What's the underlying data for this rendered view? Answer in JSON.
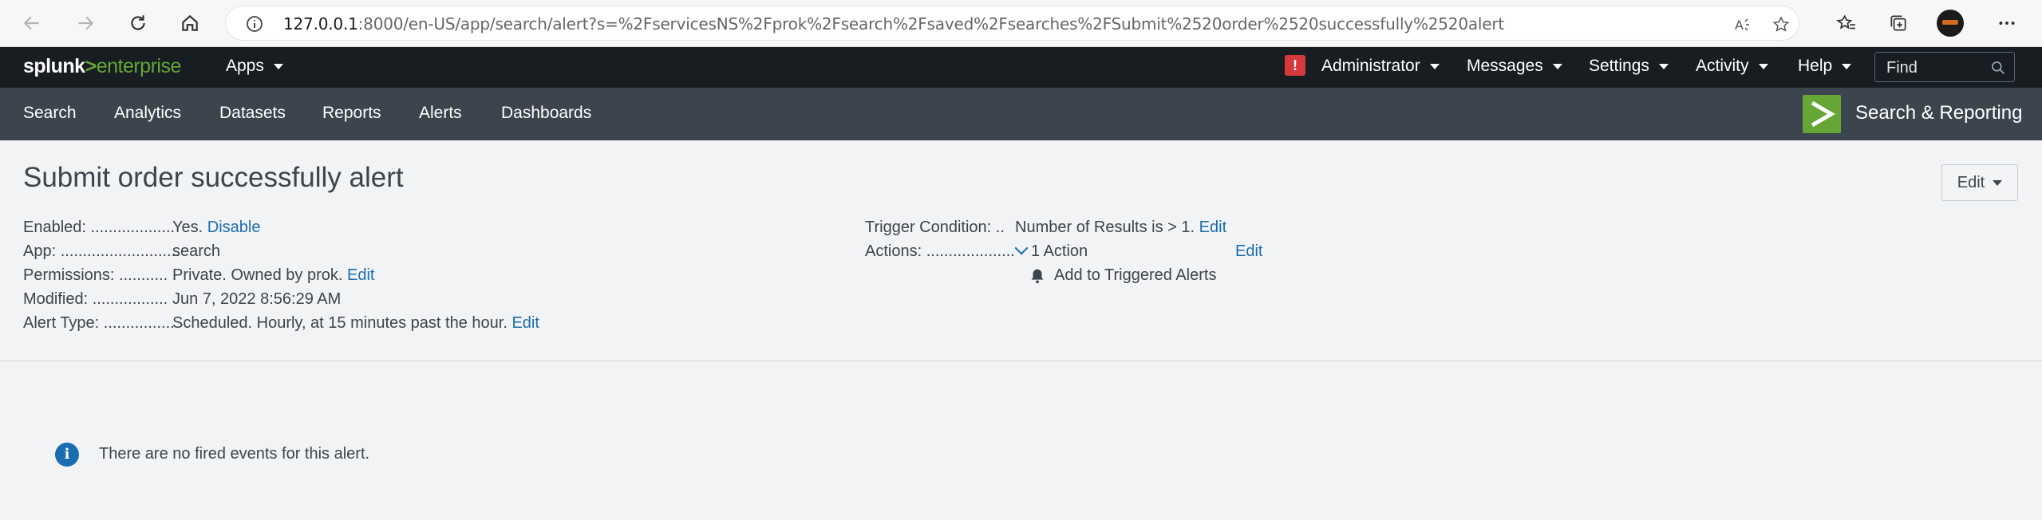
{
  "browser": {
    "url_host": "127.0.0.1",
    "url_rest": ":8000/en-US/app/search/alert?s=%2FservicesNS%2Fprok%2Fsearch%2Fsaved%2Fsearches%2FSubmit%2520order%2520successfully%2520alert"
  },
  "splunk_header": {
    "logo_splunk": "splunk",
    "logo_gt": ">",
    "logo_enterprise": "enterprise",
    "apps_label": "Apps",
    "alert_badge": "!",
    "menus": [
      "Administrator",
      "Messages",
      "Settings",
      "Activity",
      "Help"
    ],
    "find_placeholder": "Find"
  },
  "app_bar": {
    "nav": [
      "Search",
      "Analytics",
      "Datasets",
      "Reports",
      "Alerts",
      "Dashboards"
    ],
    "app_logo_glyph": ">",
    "app_title": "Search & Reporting"
  },
  "alert": {
    "title": "Submit order successfully alert",
    "edit_label": "Edit",
    "enabled_label": "Enabled: ...................",
    "enabled_value": "Yes.",
    "enabled_link": "Disable",
    "app_label": "App: ...........................",
    "app_value": "search",
    "permissions_label": "Permissions: ...........",
    "permissions_value": "Private. Owned by prok.",
    "permissions_link": "Edit",
    "modified_label": "Modified: .................",
    "modified_value": "Jun 7, 2022 8:56:29 AM",
    "alert_type_label": "Alert Type: ................",
    "alert_type_value": "Scheduled. Hourly, at 15 minutes past the hour.",
    "alert_type_link": "Edit",
    "trigger_label": "Trigger Condition: ..",
    "trigger_value": "Number of Results is > 1.",
    "trigger_link": "Edit",
    "actions_label": "Actions: ....................",
    "actions_value": "1 Action",
    "actions_link": "Edit",
    "action_item": "Add to Triggered Alerts"
  },
  "empty_state": {
    "info_glyph": "i",
    "message": "There are no fired events for this alert."
  },
  "colors": {
    "splunk_bar": "#171d21",
    "app_bar": "#3c444d",
    "accent_green": "#65a637",
    "link_blue": "#1a6db0",
    "alert_red": "#d6393c"
  }
}
